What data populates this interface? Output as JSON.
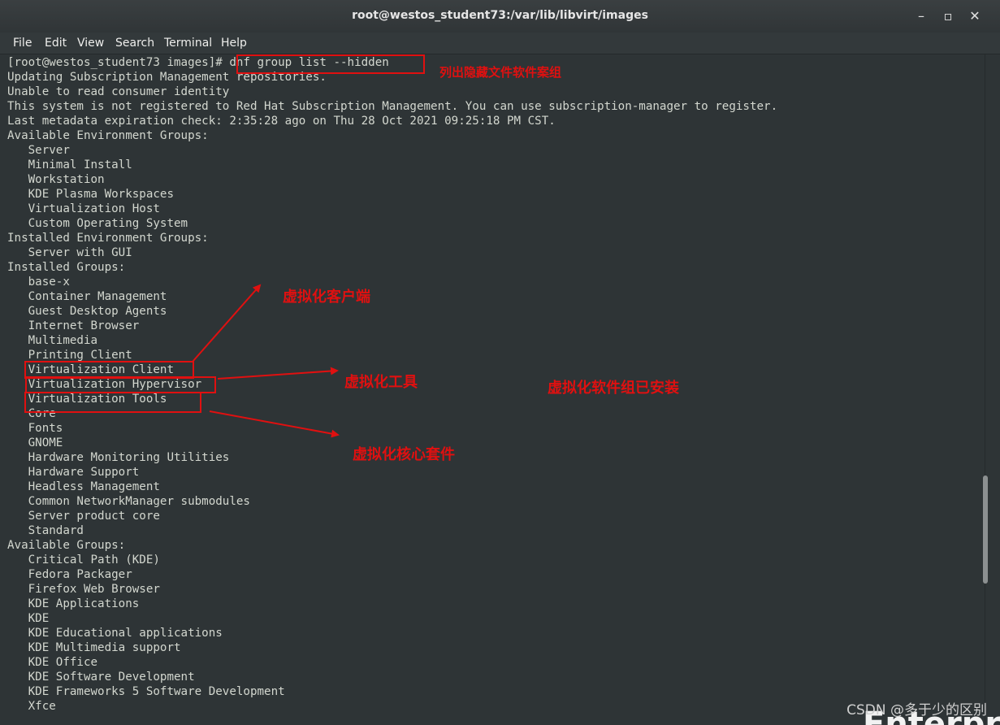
{
  "window": {
    "title": "root@westos_student73:/var/lib/libvirt/images",
    "controls": {
      "minimize": "–",
      "maximize": "▫",
      "close": "✕"
    }
  },
  "menu": [
    "File",
    "Edit",
    "View",
    "Search",
    "Terminal",
    "Help"
  ],
  "terminal": {
    "lines": [
      "[root@westos_student73 images]# dnf group list --hidden",
      "Updating Subscription Management repositories.",
      "Unable to read consumer identity",
      "This system is not registered to Red Hat Subscription Management. You can use subscription-manager to register.",
      "Last metadata expiration check: 2:35:28 ago on Thu 28 Oct 2021 09:25:18 PM CST.",
      "Available Environment Groups:",
      "   Server",
      "   Minimal Install",
      "   Workstation",
      "   KDE Plasma Workspaces",
      "   Virtualization Host",
      "   Custom Operating System",
      "Installed Environment Groups:",
      "   Server with GUI",
      "Installed Groups:",
      "   base-x",
      "   Container Management",
      "   Guest Desktop Agents",
      "   Internet Browser",
      "   Multimedia",
      "   Printing Client",
      "   Virtualization Client",
      "   Virtualization Hypervisor",
      "   Virtualization Tools",
      "   Core",
      "   Fonts",
      "   GNOME",
      "   Hardware Monitoring Utilities",
      "   Hardware Support",
      "   Headless Management",
      "   Common NetworkManager submodules",
      "   Server product core",
      "   Standard",
      "Available Groups:",
      "   Critical Path (KDE)",
      "   Fedora Packager",
      "   Firefox Web Browser",
      "   KDE Applications",
      "   KDE",
      "   KDE Educational applications",
      "   KDE Multimedia support",
      "   KDE Office",
      "   KDE Software Development",
      "   KDE Frameworks 5 Software Development",
      "   Xfce"
    ]
  },
  "annotations": {
    "hidden_list": "列出隐藏文件软件案组",
    "client": "虚拟化客户端",
    "tools": "虚拟化工具",
    "installed": "虚拟化软件组已安装",
    "core": "虚拟化核心套件"
  },
  "watermark": "CSDN @多于少的区别",
  "background_text": "Enterpris",
  "colors": {
    "annotation": "#e01010",
    "terminal_bg": "#2e3436",
    "terminal_fg": "#d3d7cf"
  }
}
